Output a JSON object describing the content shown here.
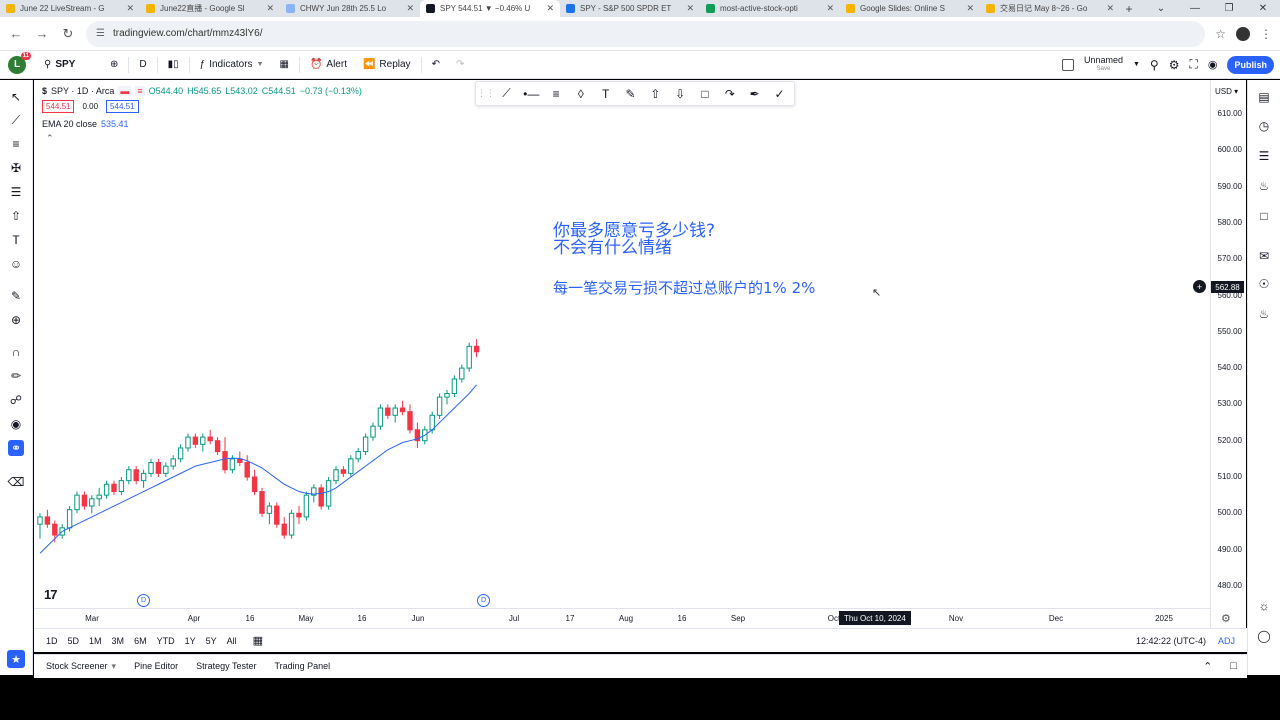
{
  "browser": {
    "tabs": [
      {
        "title": "June 22 LiveStream - G",
        "color": "#f4b400",
        "active": false
      },
      {
        "title": "June22直播 - Google Sl",
        "color": "#f4b400",
        "active": false
      },
      {
        "title": "CHWY Jun 28th 25.5 Lo",
        "color": "#8ab4f8",
        "active": false
      },
      {
        "title": "SPY 544.51 ▼ −0.46% U",
        "color": "#131722",
        "active": true
      },
      {
        "title": "SPY - S&P 500 SPDR ET",
        "color": "#1a73e8",
        "active": false
      },
      {
        "title": "most-active-stock-opti",
        "color": "#0f9d58",
        "active": false
      },
      {
        "title": "Google Slides: Online S",
        "color": "#f4b400",
        "active": false
      },
      {
        "title": "交易日记 May 8~26 - Go",
        "color": "#f4b400",
        "active": false
      }
    ],
    "url": "tradingview.com/chart/mmz43lY6/"
  },
  "toolbar": {
    "avatar_letter": "L",
    "avatar_badge": "11",
    "symbol": "SPY",
    "interval": "D",
    "indicators_label": "Indicators",
    "alert_label": "Alert",
    "replay_label": "Replay",
    "layout_name": "Unnamed",
    "layout_sub": "Save",
    "publish_label": "Publish"
  },
  "legend": {
    "title": "SPY · 1D · Arca",
    "open": "O544.40",
    "high": "H545.65",
    "low": "L543.02",
    "close": "C544.51",
    "change": "−0.73 (−0.13%)",
    "bid": "544.51",
    "spread": "0.00",
    "ask": "544.51",
    "ema_label": "EMA 20 close",
    "ema_value": "535.41"
  },
  "annotation": {
    "line1": "你最多愿意亏多少钱?",
    "line2": "不会有什么情绪",
    "line3": "每一笔交易亏损不超过总账户的1% 2%"
  },
  "price_axis": {
    "currency": "USD",
    "last_price": "562.88",
    "ticks": [
      "610.00",
      "600.00",
      "590.00",
      "580.00",
      "570.00",
      "560.00",
      "550.00",
      "540.00",
      "530.00",
      "520.00",
      "510.00",
      "500.00",
      "490.00",
      "480.00"
    ]
  },
  "time_axis": {
    "ticks": [
      "Mar",
      "Apr",
      "16",
      "May",
      "16",
      "Jun",
      "Jul",
      "17",
      "Aug",
      "16",
      "Sep",
      "Oct",
      "Nov",
      "Dec",
      "2025"
    ],
    "crosshair_date": "Thu Oct 10, 2024"
  },
  "ranges": [
    "1D",
    "5D",
    "1M",
    "3M",
    "6M",
    "YTD",
    "1Y",
    "5Y",
    "All"
  ],
  "clock": "12:42:22 (UTC-4)",
  "adj_label": "ADJ",
  "bottom_tabs": [
    "Stock Screener",
    "Pine Editor",
    "Strategy Tester",
    "Trading Panel"
  ],
  "colors": {
    "up": "#089981",
    "down": "#f23645",
    "ema": "#2962ff",
    "accent": "#2962ff"
  },
  "chart_data": {
    "type": "candlestick",
    "ylim": [
      475,
      615
    ],
    "candles_note": "",
    "ema": [
      489,
      491,
      493,
      495,
      496,
      497,
      498,
      499,
      500,
      501,
      502,
      503,
      504,
      505,
      506,
      507,
      508,
      509,
      510,
      511,
      512,
      513,
      513.5,
      514,
      514.5,
      515,
      515.2,
      515.1,
      514.5,
      513.5,
      512.5,
      511,
      509.5,
      508,
      507,
      506,
      505.5,
      505.3,
      505.5,
      506,
      507,
      508.5,
      510,
      511.5,
      513,
      514.5,
      516,
      517.5,
      518.5,
      519.5,
      520,
      520.5,
      521.5,
      523,
      525,
      527,
      529,
      531,
      533,
      535.4
    ],
    "ohlc": [
      [
        497,
        500,
        493,
        499
      ],
      [
        499,
        501,
        496,
        497
      ],
      [
        497,
        498,
        492,
        494
      ],
      [
        494,
        497,
        493,
        496
      ],
      [
        496,
        502,
        495,
        501
      ],
      [
        501,
        506,
        500,
        505
      ],
      [
        505,
        506,
        501,
        502
      ],
      [
        502,
        505,
        500,
        504
      ],
      [
        504,
        507,
        502,
        505
      ],
      [
        505,
        509,
        504,
        508
      ],
      [
        508,
        509,
        505,
        506
      ],
      [
        506,
        510,
        505,
        509
      ],
      [
        509,
        513,
        508,
        512
      ],
      [
        512,
        513,
        508,
        509
      ],
      [
        509,
        512,
        507,
        511
      ],
      [
        511,
        515,
        510,
        514
      ],
      [
        514,
        515,
        510,
        511
      ],
      [
        511,
        514,
        510,
        513
      ],
      [
        513,
        516,
        512,
        515
      ],
      [
        515,
        519,
        514,
        518
      ],
      [
        518,
        522,
        517,
        521
      ],
      [
        521,
        522,
        518,
        519
      ],
      [
        519,
        522,
        517,
        521
      ],
      [
        521,
        523,
        519,
        520
      ],
      [
        520,
        521,
        516,
        517
      ],
      [
        517,
        521,
        511,
        512
      ],
      [
        512,
        516,
        511,
        515
      ],
      [
        515,
        517,
        513,
        514
      ],
      [
        514,
        516,
        509,
        510
      ],
      [
        510,
        512,
        505,
        506
      ],
      [
        506,
        507,
        499,
        500
      ],
      [
        500,
        503,
        497,
        502
      ],
      [
        502,
        503,
        496,
        497
      ],
      [
        497,
        499,
        493,
        494
      ],
      [
        494,
        501,
        493,
        500
      ],
      [
        500,
        502,
        497,
        499
      ],
      [
        499,
        506,
        498,
        505
      ],
      [
        505,
        508,
        503,
        507
      ],
      [
        507,
        508,
        501,
        502
      ],
      [
        502,
        510,
        501,
        509
      ],
      [
        509,
        513,
        508,
        512
      ],
      [
        512,
        513,
        510,
        511
      ],
      [
        511,
        516,
        510,
        515
      ],
      [
        515,
        518,
        514,
        517
      ],
      [
        517,
        522,
        516,
        521
      ],
      [
        521,
        525,
        520,
        524
      ],
      [
        524,
        530,
        523,
        529
      ],
      [
        529,
        530,
        526,
        527
      ],
      [
        527,
        530,
        525,
        529
      ],
      [
        529,
        531,
        527,
        528
      ],
      [
        528,
        530,
        522,
        523
      ],
      [
        523,
        525,
        518,
        520
      ],
      [
        520,
        524,
        519,
        523
      ],
      [
        523,
        528,
        522,
        527
      ],
      [
        527,
        533,
        526,
        532
      ],
      [
        532,
        534,
        530,
        533
      ],
      [
        533,
        538,
        532,
        537
      ],
      [
        537,
        541,
        536,
        540
      ],
      [
        540,
        547,
        539,
        546
      ],
      [
        546,
        548,
        543,
        544.5
      ]
    ]
  }
}
